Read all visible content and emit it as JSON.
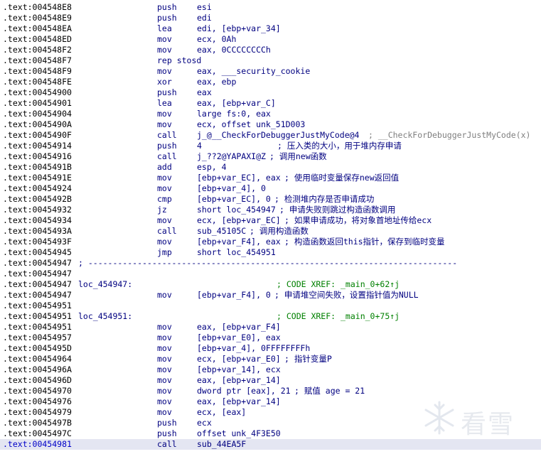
{
  "lines": [
    {
      "addr": ".text:004548E8",
      "mn": "push",
      "ops": "esi"
    },
    {
      "addr": ".text:004548E9",
      "mn": "push",
      "ops": "edi"
    },
    {
      "addr": ".text:004548EA",
      "mn": "lea",
      "ops": "edi, [ebp+var_34]"
    },
    {
      "addr": ".text:004548ED",
      "mn": "mov",
      "ops": "ecx, 0Ah"
    },
    {
      "addr": ".text:004548F2",
      "mn": "mov",
      "ops": "eax, 0CCCCCCCCh"
    },
    {
      "addr": ".text:004548F7",
      "mn": "rep stosd",
      "ops": ""
    },
    {
      "addr": ".text:004548F9",
      "mn": "mov",
      "ops": "eax, ___security_cookie"
    },
    {
      "addr": ".text:004548FE",
      "mn": "xor",
      "ops": "eax, ebp"
    },
    {
      "addr": ".text:00454900",
      "mn": "push",
      "ops": "eax"
    },
    {
      "addr": ".text:00454901",
      "mn": "lea",
      "ops": "eax, [ebp+var_C]"
    },
    {
      "addr": ".text:00454904",
      "mn": "mov",
      "ops": "large fs:0, eax"
    },
    {
      "addr": ".text:0045490A",
      "mn": "mov",
      "ops": "ecx, offset unk_51D003"
    },
    {
      "addr": ".text:0045490F",
      "mn": "call",
      "ops": "j_@__CheckForDebuggerJustMyCode@4",
      "cm": "; __CheckForDebuggerJustMyCode(x)"
    },
    {
      "addr": ".text:00454914",
      "mn": "push",
      "ops": "4",
      "cm": "; 压入类的大小，用于堆内存申请"
    },
    {
      "addr": ".text:00454916",
      "mn": "call",
      "ops": "j_??2@YAPAXI@Z",
      "cm": "; 调用new函数"
    },
    {
      "addr": ".text:0045491B",
      "mn": "add",
      "ops": "esp, 4"
    },
    {
      "addr": ".text:0045491E",
      "mn": "mov",
      "ops": "[ebp+var_EC], eax",
      "cm": "; 使用临时变量保存new返回值"
    },
    {
      "addr": ".text:00454924",
      "mn": "mov",
      "ops": "[ebp+var_4], 0"
    },
    {
      "addr": ".text:0045492B",
      "mn": "cmp",
      "ops": "[ebp+var_EC], 0",
      "cm": "; 检测堆内存是否申请成功"
    },
    {
      "addr": ".text:00454932",
      "mn": "jz",
      "ops": "short loc_454947",
      "cm": "; 申请失败则跳过构造函数调用"
    },
    {
      "addr": ".text:00454934",
      "mn": "mov",
      "ops": "ecx, [ebp+var_EC]",
      "cm": "; 如果申请成功，将对象首地址传给ecx"
    },
    {
      "addr": ".text:0045493A",
      "mn": "call",
      "ops": "sub_45105C",
      "cm": "; 调用构造函数"
    },
    {
      "addr": ".text:0045493F",
      "mn": "mov",
      "ops": "[ebp+var_F4], eax",
      "cm": "; 构造函数返回this指针，保存到临时变量"
    },
    {
      "addr": ".text:00454945",
      "mn": "jmp",
      "ops": "short loc_454951"
    },
    {
      "addr": ".text:00454947",
      "sep": "; ---------------------------------------------------------------------------"
    },
    {
      "addr": ".text:00454947"
    },
    {
      "addr": ".text:00454947",
      "label": "loc_454947:",
      "xref": "; CODE XREF: _main_0+62↑j"
    },
    {
      "addr": ".text:00454947",
      "mn": "mov",
      "ops": "[ebp+var_F4], 0",
      "cm": "; 申请堆空间失败，设置指针值为NULL"
    },
    {
      "addr": ".text:00454951"
    },
    {
      "addr": ".text:00454951",
      "label": "loc_454951:",
      "xref": "; CODE XREF: _main_0+75↑j"
    },
    {
      "addr": ".text:00454951",
      "mn": "mov",
      "ops": "eax, [ebp+var_F4]"
    },
    {
      "addr": ".text:00454957",
      "mn": "mov",
      "ops": "[ebp+var_E0], eax"
    },
    {
      "addr": ".text:0045495D",
      "mn": "mov",
      "ops": "[ebp+var_4], 0FFFFFFFFh"
    },
    {
      "addr": ".text:00454964",
      "mn": "mov",
      "ops": "ecx, [ebp+var_E0]",
      "cm": "; 指针变量P"
    },
    {
      "addr": ".text:0045496A",
      "mn": "mov",
      "ops": "[ebp+var_14], ecx"
    },
    {
      "addr": ".text:0045496D",
      "mn": "mov",
      "ops": "eax, [ebp+var_14]"
    },
    {
      "addr": ".text:00454970",
      "mn": "mov",
      "ops": "dword ptr [eax], 21",
      "cm": "; 赋值 age = 21"
    },
    {
      "addr": ".text:00454976",
      "mn": "mov",
      "ops": "eax, [ebp+var_14]"
    },
    {
      "addr": ".text:00454979",
      "mn": "mov",
      "ops": "ecx, [eax]"
    },
    {
      "addr": ".text:0045497B",
      "mn": "push",
      "ops": "ecx"
    },
    {
      "addr": ".text:0045497C",
      "mn": "push",
      "ops": "offset unk_4F3E50"
    },
    {
      "addr": ".text:00454981",
      "mn": "call",
      "ops": "sub_44EA5F",
      "current": true
    }
  ],
  "watermark": "看雪",
  "colors": {
    "text": "#000080",
    "comment": "#008000",
    "highlight": "#e4e6f2"
  }
}
